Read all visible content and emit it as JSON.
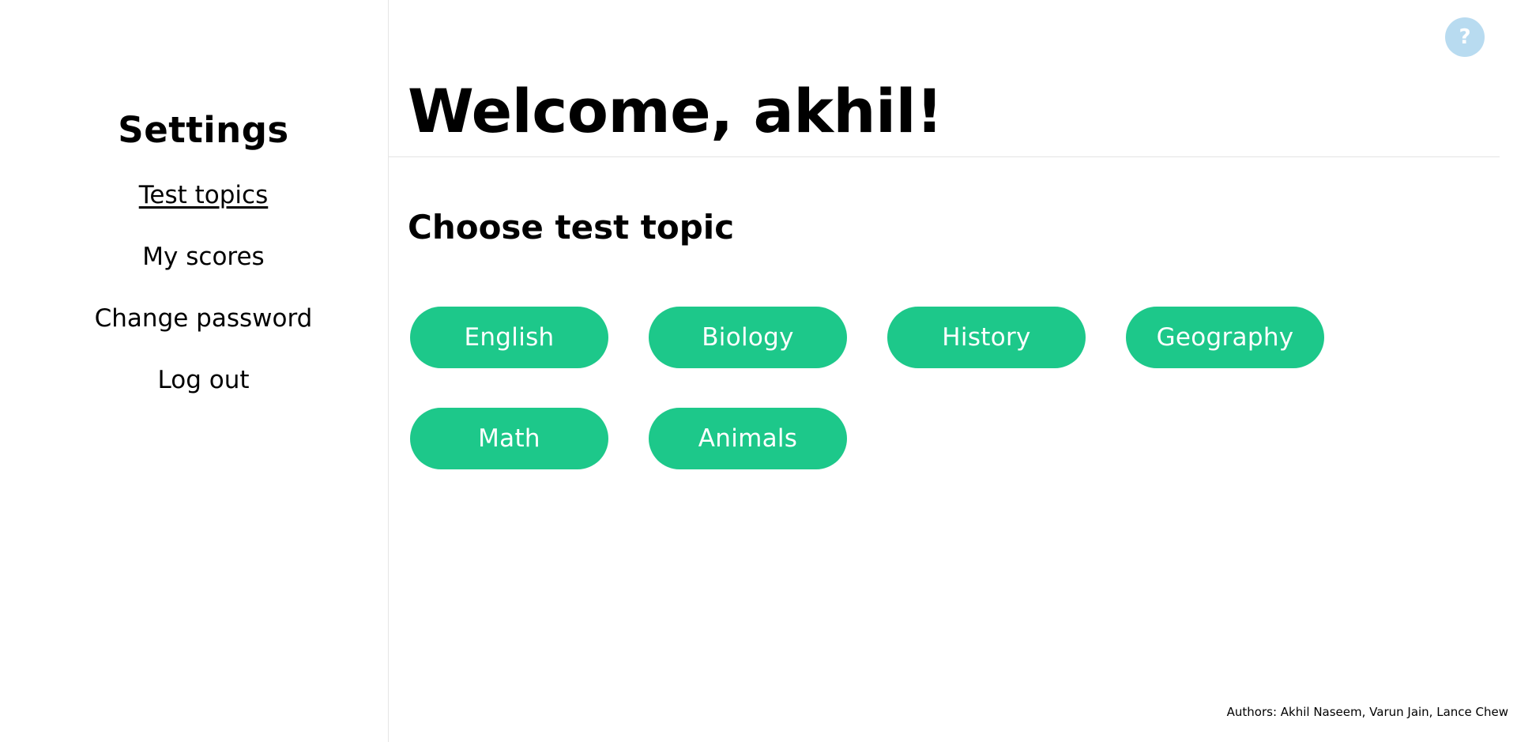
{
  "sidebar": {
    "title": "Settings",
    "items": [
      {
        "label": "Test topics",
        "active": true
      },
      {
        "label": "My scores",
        "active": false
      },
      {
        "label": "Change password",
        "active": false
      },
      {
        "label": "Log out",
        "active": false
      }
    ]
  },
  "help": {
    "label": "?",
    "icon": "question-icon"
  },
  "header": {
    "welcome": "Welcome, akhil!"
  },
  "main": {
    "heading": "Choose test topic",
    "topics": [
      "English",
      "Biology",
      "History",
      "Geography",
      "Math",
      "Animals"
    ]
  },
  "footer": {
    "authors": "Authors: Akhil Naseem, Varun Jain, Lance Chew"
  },
  "colors": {
    "accent": "#1dc88a",
    "help_button": "#b8dbf0",
    "divider": "#e4e4e4"
  }
}
